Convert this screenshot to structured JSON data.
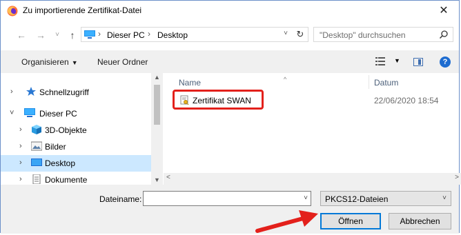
{
  "window": {
    "title": "Zu importierende Zertifikat-Datei",
    "close_glyph": "✕"
  },
  "nav": {
    "back_glyph": "←",
    "forward_glyph": "→",
    "recent_glyph": "˅",
    "up_glyph": "↑"
  },
  "address": {
    "crumbs": [
      "Dieser PC",
      "Desktop"
    ],
    "separator": "›",
    "dropdown_glyph": "˅",
    "refresh_glyph": "↻"
  },
  "search": {
    "placeholder": "\"Desktop\" durchsuchen"
  },
  "toolbar": {
    "organize_label": "Organisieren",
    "organize_caret": "▼",
    "new_folder_label": "Neuer Ordner",
    "view_caret": "▼",
    "help_label": "?"
  },
  "sidebar": {
    "items": [
      {
        "label": "Schnellzugriff",
        "icon": "star-icon",
        "arrow": "›"
      },
      {
        "label": "Dieser PC",
        "icon": "computer-icon",
        "arrow": "˅"
      },
      {
        "label": "3D-Objekte",
        "icon": "cube-icon",
        "arrow": "›"
      },
      {
        "label": "Bilder",
        "icon": "pictures-icon",
        "arrow": "›"
      },
      {
        "label": "Desktop",
        "icon": "desktop-icon",
        "arrow": "›",
        "selected": true
      },
      {
        "label": "Dokumente",
        "icon": "documents-icon",
        "arrow": "›"
      }
    ]
  },
  "filelist": {
    "columns": {
      "name": "Name",
      "date": "Datum"
    },
    "sort_glyph": "^",
    "files": [
      {
        "name": "Zertifikat SWAN",
        "date": "22/06/2020 18:54",
        "icon": "certificate-icon"
      }
    ]
  },
  "scrollbars": {
    "up": "▲",
    "down": "▼",
    "left": "<",
    "right": ">"
  },
  "bottom": {
    "filename_label": "Dateiname:",
    "filename_value": "",
    "filename_dd_glyph": "˅",
    "filetype": "PKCS12-Dateien",
    "filetype_dd_glyph": "˅",
    "open_label": "Öffnen",
    "cancel_label": "Abbrechen"
  },
  "colors": {
    "highlight_red": "#e3201b",
    "selection_blue": "#cce8ff",
    "accent_blue": "#0078d7"
  }
}
